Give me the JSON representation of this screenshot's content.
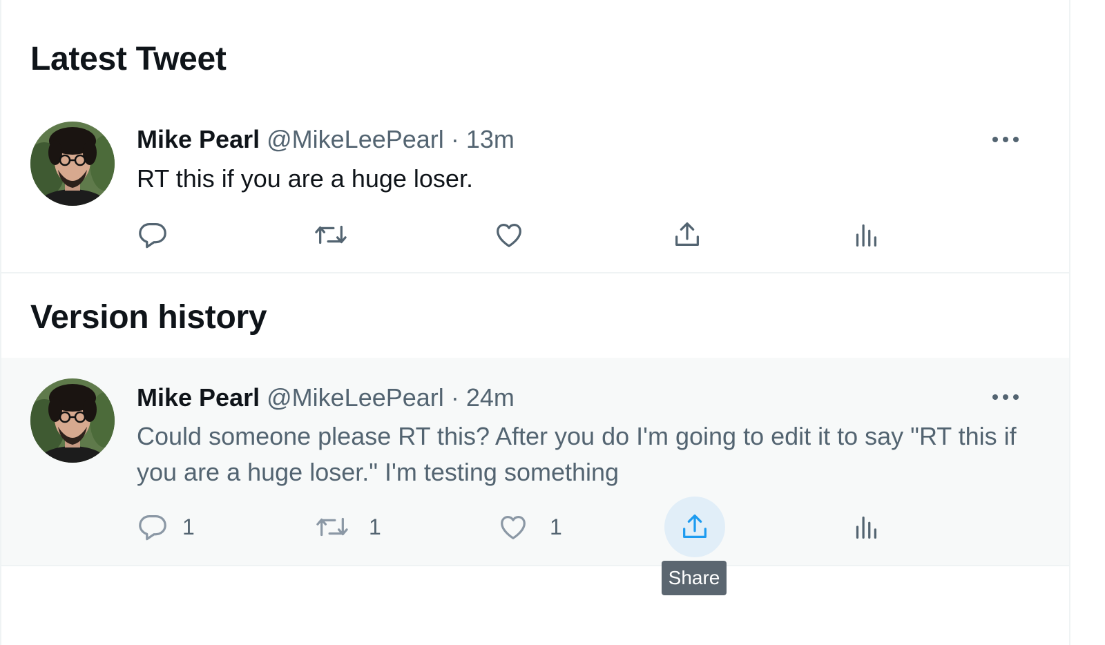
{
  "sections": {
    "latest_title": "Latest Tweet",
    "history_title": "Version history"
  },
  "latest_tweet": {
    "author_name": "Mike Pearl",
    "author_handle": "@MikeLeePearl",
    "separator": "·",
    "time": "13m",
    "text": "RT this if you are a huge loser.",
    "icons": [
      "reply-icon",
      "retweet-icon",
      "like-icon",
      "share-icon",
      "analytics-icon",
      "more-icon"
    ]
  },
  "history_tweet": {
    "author_name": "Mike Pearl",
    "author_handle": "@MikeLeePearl",
    "separator": "·",
    "time": "24m",
    "text": "Could someone please RT this? After you do I'm going to edit it to say \"RT this if you are a huge loser.\" I'm testing something",
    "reply_count": "1",
    "retweet_count": "1",
    "like_count": "1",
    "icons": [
      "reply-icon",
      "retweet-icon",
      "like-icon",
      "share-icon",
      "analytics-icon",
      "more-icon"
    ]
  },
  "tooltip": {
    "label": "Share"
  },
  "colors": {
    "text_primary": "#0f1419",
    "text_secondary": "#536471",
    "accent": "#1d9bf0",
    "history_bg": "#f7f9f9",
    "hover_bg": "#e1eef8",
    "tooltip_bg": "#5b6670"
  }
}
